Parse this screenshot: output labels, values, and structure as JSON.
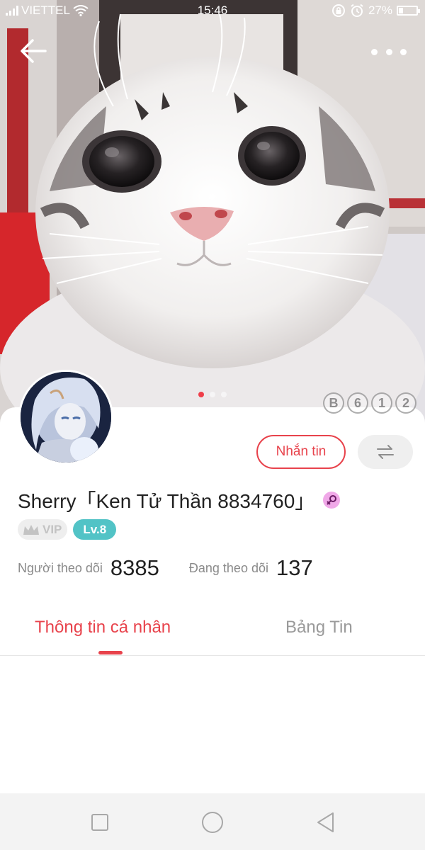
{
  "status_bar": {
    "carrier": "VIETTEL",
    "time": "15:46",
    "battery_text": "27%",
    "battery_level": 0.27,
    "icons": [
      "signal-icon",
      "wifi-icon",
      "lock-rotation-icon",
      "alarm-icon",
      "battery-icon"
    ]
  },
  "nav": {
    "back_icon": "arrow-left-icon",
    "more_icon": "more-horizontal-icon"
  },
  "cover": {
    "carousel_total": 3,
    "carousel_active_index": 0,
    "badges": [
      "B",
      "6",
      "1",
      "2"
    ]
  },
  "profile": {
    "message_button": "Nhắn tin",
    "switch_icon": "swap-arrows-icon",
    "username": "Sherry「Ken Tử Thần 8834760」",
    "gender_icon": "female-icon",
    "vip_label": "VIP",
    "level_label": "Lv.8"
  },
  "stats": {
    "followers_label": "Người theo dõi",
    "followers_value": "8385",
    "following_label": "Đang theo dõi",
    "following_value": "137"
  },
  "tabs": [
    {
      "label": "Thông tin cá nhân",
      "active": true
    },
    {
      "label": "Bảng Tin",
      "active": false
    }
  ],
  "system_nav": [
    "square-recent-icon",
    "circle-home-icon",
    "triangle-back-icon"
  ],
  "colors": {
    "accent": "#e8434c",
    "level_badge": "#52c3c6",
    "vip_badge_bg": "#eeeeee",
    "gender_badge": "#f0a8e8",
    "system_nav_bg": "#f3f3f3"
  }
}
